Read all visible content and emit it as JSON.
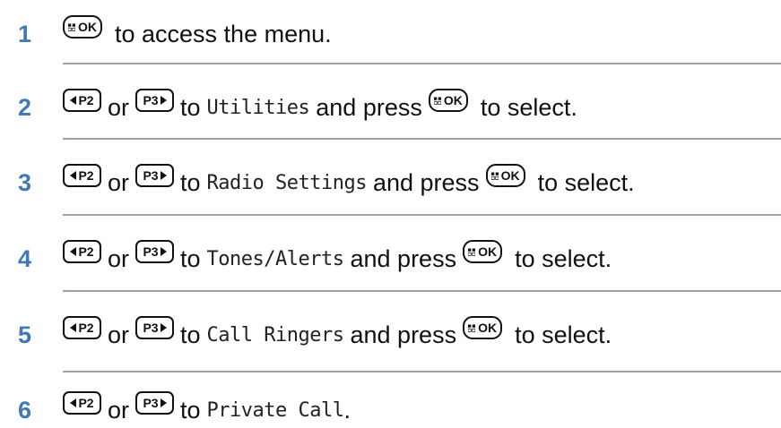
{
  "keys": {
    "ok": "OK",
    "p2": "P2",
    "p3": "P3"
  },
  "steps": [
    {
      "num": "1",
      "text_a": "to access the menu."
    },
    {
      "num": "2",
      "or": "or",
      "to": "to",
      "menu": "Utilities",
      "press": "and press",
      "select": "to select."
    },
    {
      "num": "3",
      "or": "or",
      "to": "to",
      "menu": "Radio Settings",
      "press": "and press",
      "select": "to select."
    },
    {
      "num": "4",
      "or": "or",
      "to": "to",
      "menu": "Tones/Alerts",
      "press": "and press",
      "select": "to select."
    },
    {
      "num": "5",
      "or": "or",
      "to": "to",
      "menu": "Call Ringers",
      "press": "and press",
      "select": "to select."
    },
    {
      "num": "6",
      "or": "or",
      "to": "to",
      "menu": "Private Call",
      "end": "."
    }
  ],
  "colors": {
    "step_number": "#3f79b6",
    "divider": "#9aa3ab"
  }
}
